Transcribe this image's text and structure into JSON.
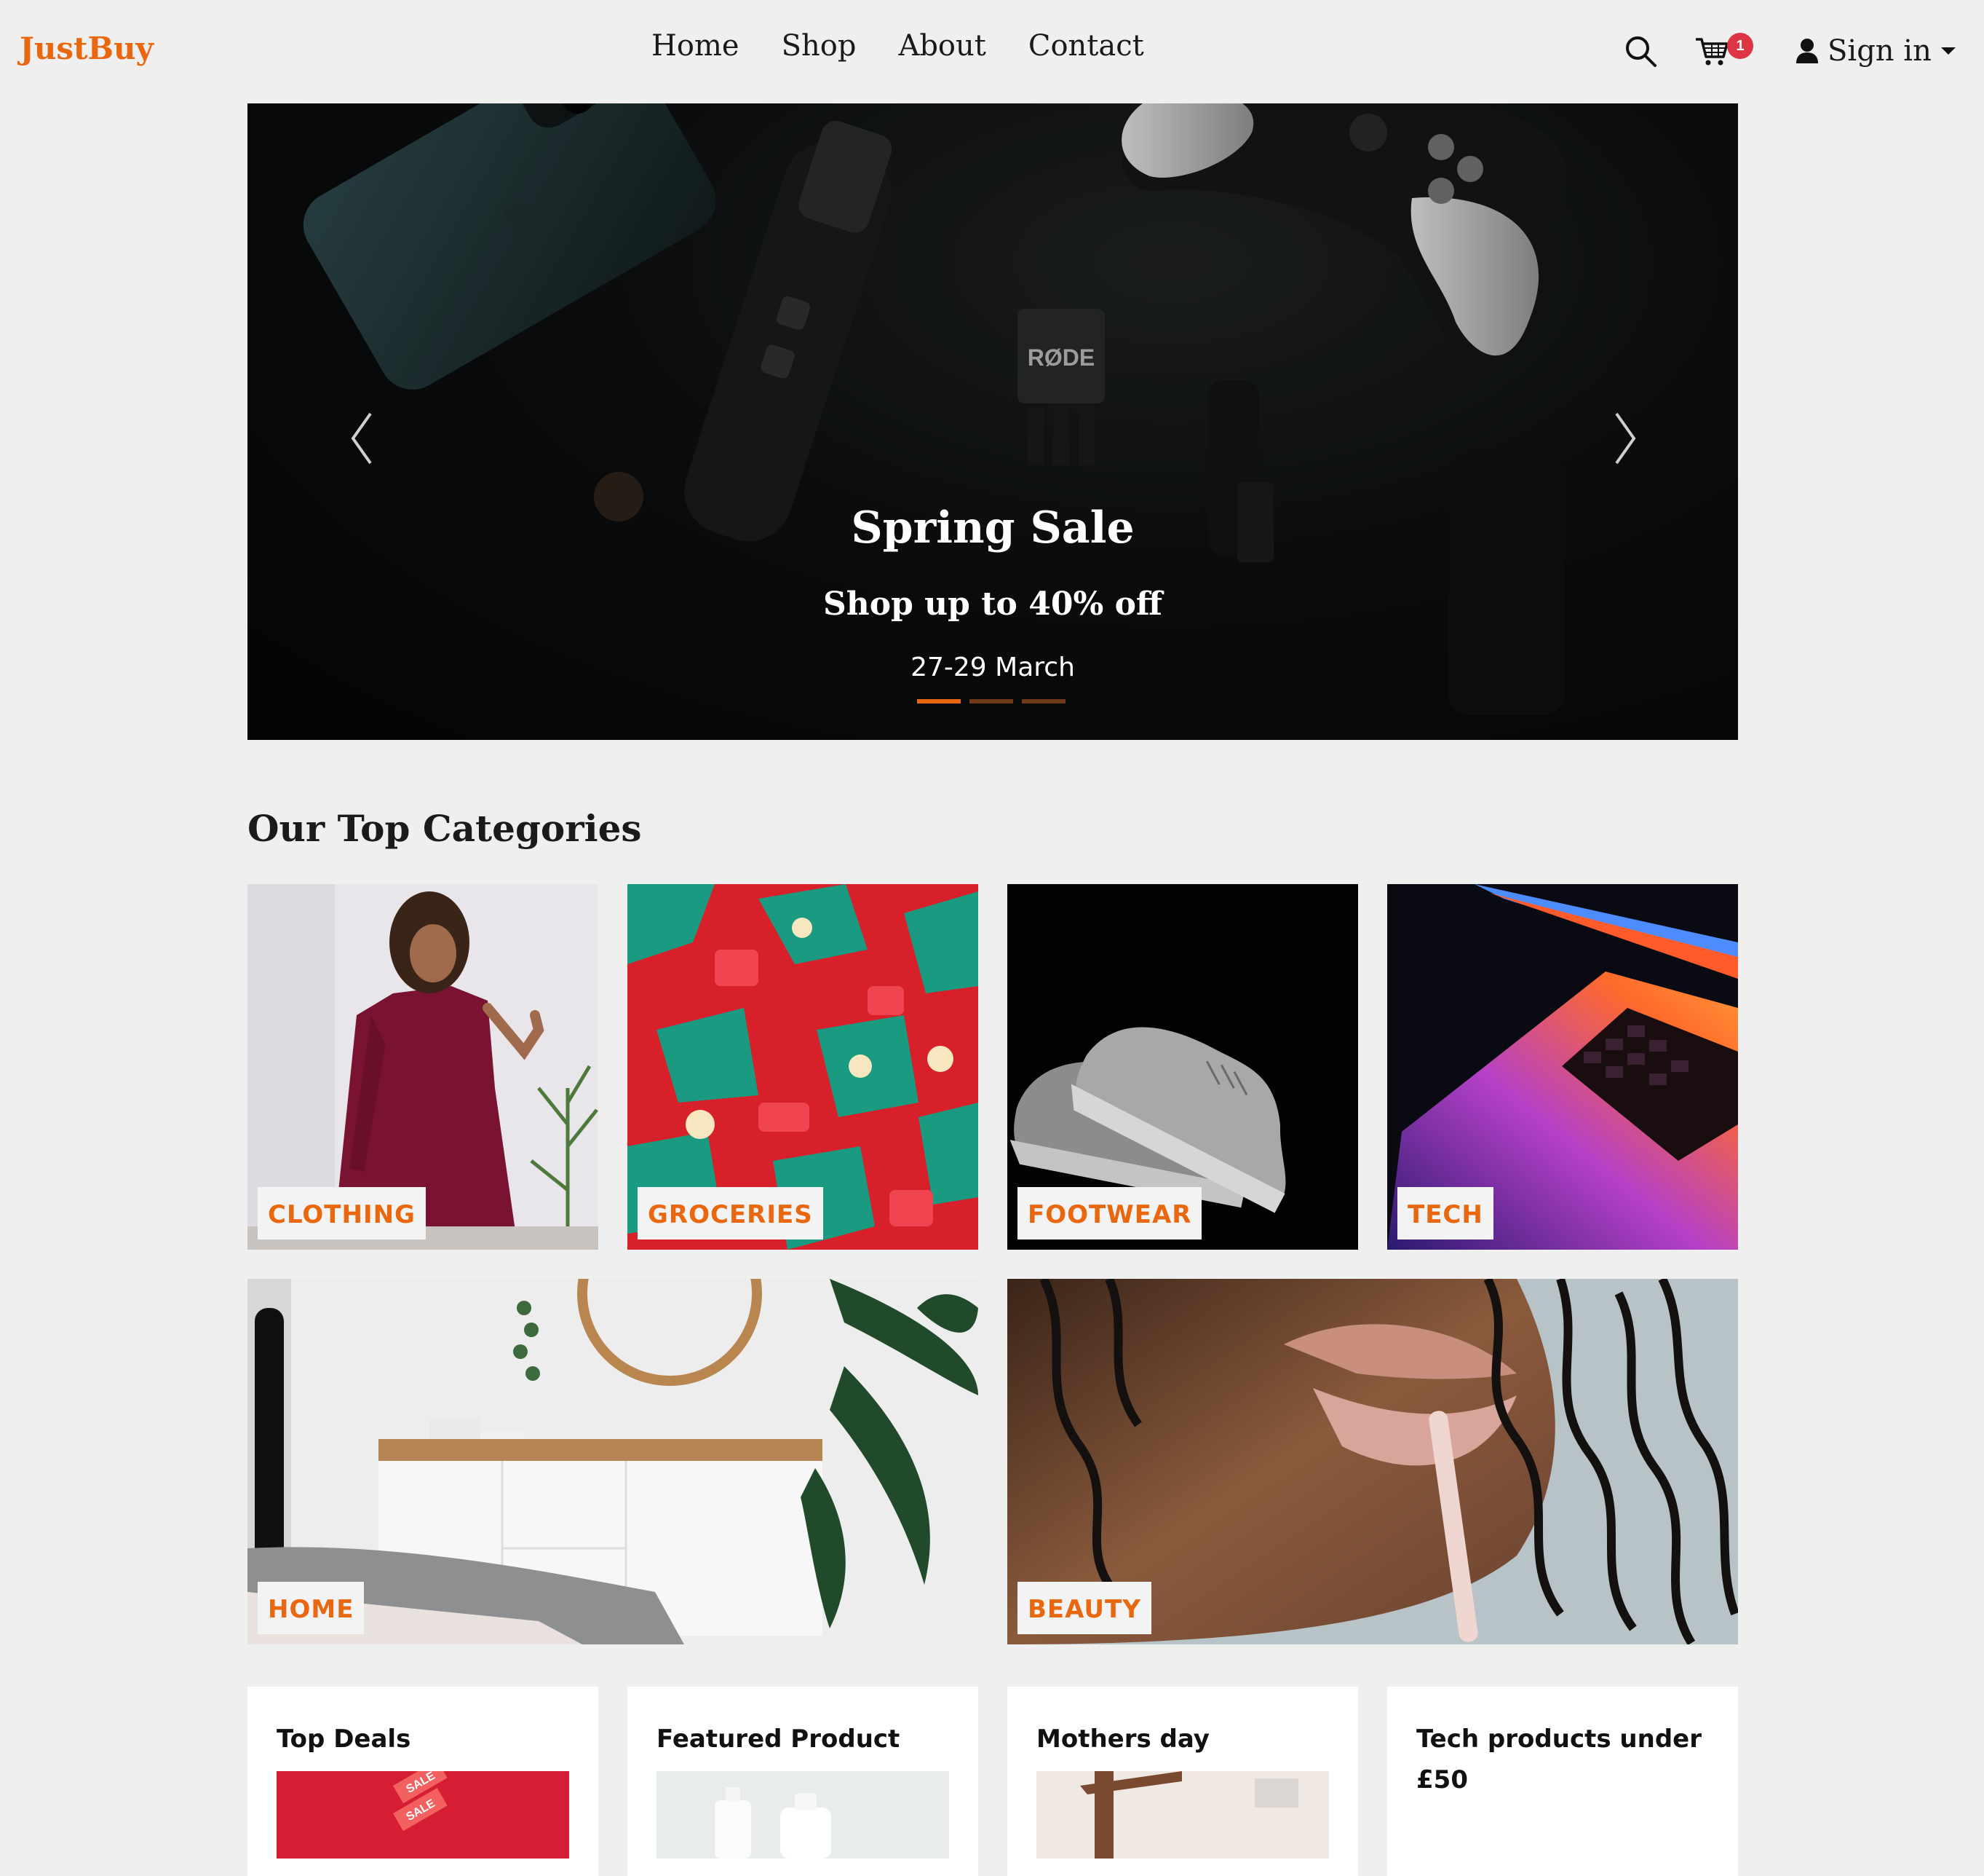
{
  "brand": "JustBuy",
  "nav": {
    "links": [
      "Home",
      "Shop",
      "About",
      "Contact"
    ],
    "cart_count": "1",
    "signin_label": "Sign in"
  },
  "hero": {
    "title": "Spring Sale",
    "subtitle": "Shop up to 40% off",
    "date": "27-29 March",
    "product_text": "RØDE",
    "active_slide": 1,
    "slide_count": 3
  },
  "categories": {
    "title": "Our Top Categories",
    "items": [
      "CLOTHING",
      "GROCERIES",
      "FOOTWEAR",
      "TECH",
      "HOME",
      "BEAUTY"
    ]
  },
  "cards": [
    {
      "title": "Top Deals"
    },
    {
      "title": "Featured Product"
    },
    {
      "title": "Mothers day"
    },
    {
      "title": "Tech products under £50"
    }
  ],
  "tags": {
    "sale": "SALE"
  },
  "colors": {
    "accent": "#e8670f",
    "background": "#efefef",
    "badge": "#dc3545"
  }
}
